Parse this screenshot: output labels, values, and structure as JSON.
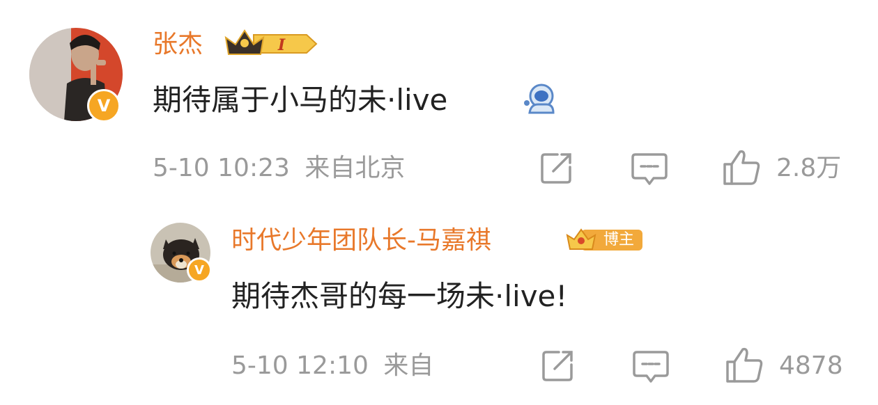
{
  "comments": [
    {
      "username": "张杰",
      "level_badge": "I",
      "content": "期待属于小马的未·live",
      "emoji": "astronaut-emoji",
      "time": "5-10 10:23",
      "location": "来自北京",
      "likes": "2.8万",
      "icons": [
        "share-icon",
        "comment-icon",
        "like-icon"
      ]
    },
    {
      "username": "时代少年团队长-马嘉祺",
      "tag": "博主",
      "content": "期待杰哥的每一场未·live!",
      "time": "5-10 12:10",
      "location": "来自",
      "likes": "4878",
      "icons": [
        "share-icon",
        "comment-icon",
        "like-icon"
      ]
    }
  ],
  "colors": {
    "username": "#e8782a",
    "meta": "#9a9a9a",
    "text": "#222222",
    "verified": "#f6a623"
  }
}
